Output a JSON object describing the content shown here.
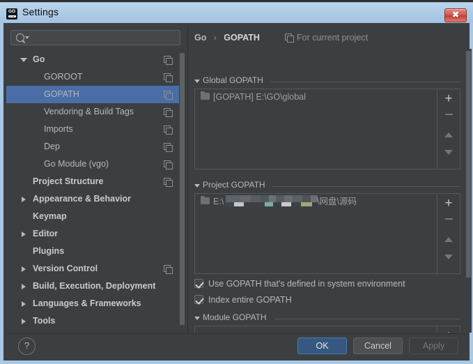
{
  "window": {
    "title": "Settings",
    "app_icon": "goland-go-icon",
    "close_label": "✖"
  },
  "search": {
    "value": "",
    "placeholder": "",
    "icon": "search-icon",
    "dropdown_icon": "chevron-down-icon"
  },
  "sidebar": {
    "items": [
      {
        "label": "Go",
        "level": 0,
        "arrow": "open",
        "selected": false,
        "copy_icon": true
      },
      {
        "label": "GOROOT",
        "level": 1,
        "arrow": "none",
        "selected": false,
        "copy_icon": true
      },
      {
        "label": "GOPATH",
        "level": 1,
        "arrow": "none",
        "selected": true,
        "copy_icon": true
      },
      {
        "label": "Vendoring & Build Tags",
        "level": 1,
        "arrow": "none",
        "selected": false,
        "copy_icon": true
      },
      {
        "label": "Imports",
        "level": 1,
        "arrow": "none",
        "selected": false,
        "copy_icon": true
      },
      {
        "label": "Dep",
        "level": 1,
        "arrow": "none",
        "selected": false,
        "copy_icon": true
      },
      {
        "label": "Go Module (vgo)",
        "level": 1,
        "arrow": "none",
        "selected": false,
        "copy_icon": true
      },
      {
        "label": "Project Structure",
        "level": 0,
        "arrow": "none",
        "selected": false,
        "copy_icon": true
      },
      {
        "label": "Appearance & Behavior",
        "level": 0,
        "arrow": "closed",
        "selected": false,
        "copy_icon": false
      },
      {
        "label": "Keymap",
        "level": 0,
        "arrow": "none",
        "selected": false,
        "copy_icon": false
      },
      {
        "label": "Editor",
        "level": 0,
        "arrow": "closed",
        "selected": false,
        "copy_icon": false
      },
      {
        "label": "Plugins",
        "level": 0,
        "arrow": "none",
        "selected": false,
        "copy_icon": false
      },
      {
        "label": "Version Control",
        "level": 0,
        "arrow": "closed",
        "selected": false,
        "copy_icon": true
      },
      {
        "label": "Build, Execution, Deployment",
        "level": 0,
        "arrow": "closed",
        "selected": false,
        "copy_icon": false
      },
      {
        "label": "Languages & Frameworks",
        "level": 0,
        "arrow": "closed",
        "selected": false,
        "copy_icon": false
      },
      {
        "label": "Tools",
        "level": 0,
        "arrow": "closed",
        "selected": false,
        "copy_icon": false
      }
    ]
  },
  "main": {
    "breadcrumb": {
      "parent": "Go",
      "separator": "›",
      "current": "GOPATH"
    },
    "for_current_project": {
      "label": "For current project",
      "icon": "copy-icon"
    },
    "global_gopath": {
      "title": "Global GOPATH",
      "entries": [
        {
          "text": "[GOPATH] E:\\GO\\global",
          "icon": "folder-icon"
        }
      ],
      "add_label": "+",
      "remove_label": "−",
      "up_label": "▲",
      "down_label": "▼"
    },
    "project_gopath": {
      "title": "Project GOPATH",
      "entries": [
        {
          "prefix": "E:\\",
          "redacted": true,
          "suffix": "\\网盘\\源码",
          "icon": "folder-icon"
        }
      ],
      "add_label": "+",
      "remove_label": "−",
      "up_label": "▲",
      "down_label": "▼"
    },
    "checkboxes": [
      {
        "label": "Use GOPATH that's defined in system environment",
        "checked": true
      },
      {
        "label": "Index entire GOPATH",
        "checked": true
      }
    ],
    "module_gopath": {
      "title": "Module GOPATH",
      "entries": [],
      "add_label": "+"
    }
  },
  "footer": {
    "help_label": "?",
    "ok_label": "OK",
    "cancel_label": "Cancel",
    "apply_label": "Apply",
    "apply_enabled": false
  },
  "colors": {
    "accent_selection": "#4a6da7",
    "ok_button": "#365880",
    "panel_bg": "#3c3f41",
    "titlebar": "#a9c8e4",
    "close_button": "#c43b30"
  }
}
